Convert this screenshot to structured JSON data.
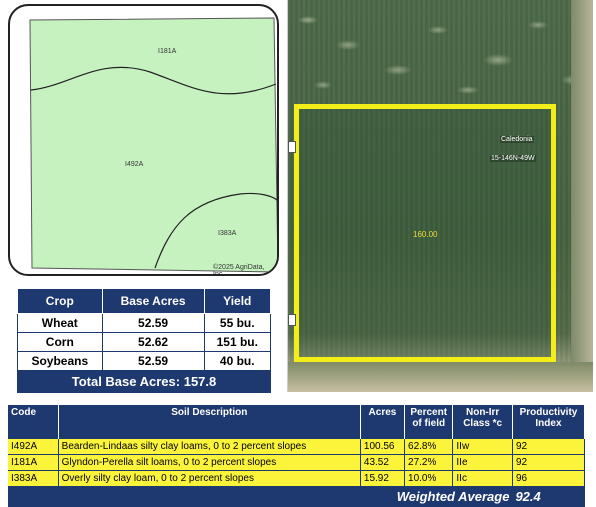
{
  "soil_map": {
    "labels": {
      "i181a": "I181A",
      "i492a": "I492A",
      "i383a": "I383A"
    },
    "copyright": "©2025 AgriData, Inc."
  },
  "base_acres": {
    "headers": {
      "crop": "Crop",
      "base_acres": "Base Acres",
      "yield": "Yield"
    },
    "rows": [
      {
        "crop": "Wheat",
        "base_acres": "52.59",
        "yield": "55 bu."
      },
      {
        "crop": "Corn",
        "base_acres": "52.62",
        "yield": "151 bu."
      },
      {
        "crop": "Soybeans",
        "base_acres": "52.59",
        "yield": "40 bu."
      }
    ],
    "total_label": "Total Base Acres:",
    "total_value": "157.8"
  },
  "aerial": {
    "acres_label": "160.00",
    "township_label": "Caledonia",
    "section_label": "15-146N-49W"
  },
  "soil_table": {
    "headers": {
      "code": "Code",
      "description": "Soil Description",
      "acres": "Acres",
      "percent": "Percent of field",
      "class": "Non-Irr Class *c",
      "pi": "Productivity Index"
    },
    "rows": [
      {
        "code": "I492A",
        "description": "Bearden-Lindaas silty clay loams, 0 to 2 percent slopes",
        "acres": "100.56",
        "percent": "62.8%",
        "class": "IIw",
        "pi": "92"
      },
      {
        "code": "I181A",
        "description": "Glyndon-Perella silt loams, 0 to 2 percent slopes",
        "acres": "43.52",
        "percent": "27.2%",
        "class": "IIe",
        "pi": "92"
      },
      {
        "code": "I383A",
        "description": "Overly silty clay loam, 0 to 2 percent slopes",
        "acres": "15.92",
        "percent": "10.0%",
        "class": "IIc",
        "pi": "96"
      }
    ],
    "weighted_label": "Weighted Average",
    "weighted_value": "92.4"
  },
  "colors": {
    "navy": "#1e3870",
    "highlight_yellow": "#fbf43a",
    "map_green": "#c6f2c0",
    "boundary_yellow": "#f3ee18"
  }
}
